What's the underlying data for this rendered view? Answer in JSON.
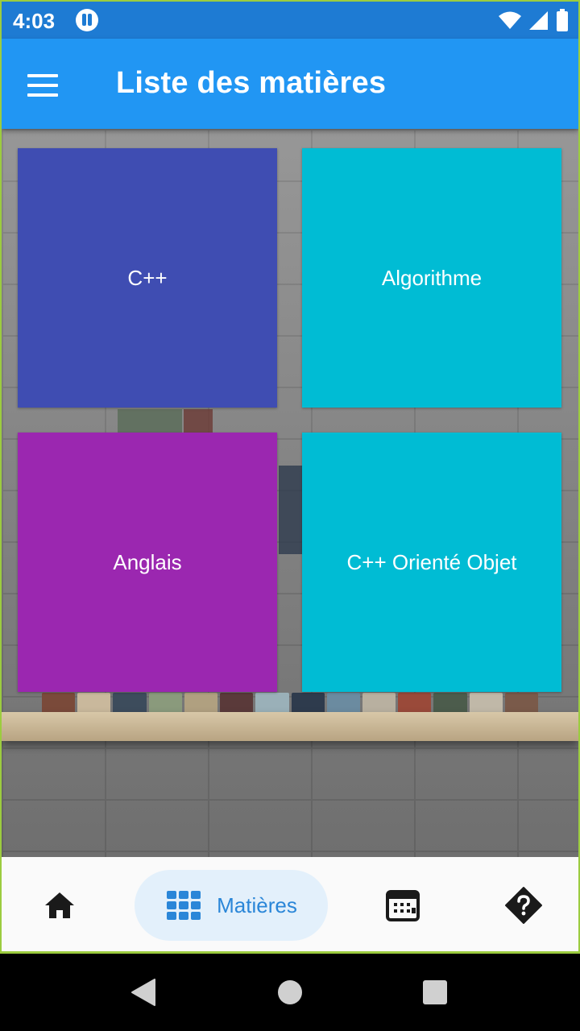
{
  "status_bar": {
    "time": "4:03",
    "icons": [
      "app-notification-icon",
      "wifi-icon",
      "cell-signal-icon",
      "battery-icon"
    ]
  },
  "app_bar": {
    "title": "Liste des matières",
    "menu_icon": "menu-icon"
  },
  "subjects": [
    {
      "label": "C++",
      "color": "#3f4db2"
    },
    {
      "label": "Algorithme",
      "color": "#00bcd4"
    },
    {
      "label": "Anglais",
      "color": "#9b27b0"
    },
    {
      "label": "C++ Orienté Objet",
      "color": "#00bcd4"
    }
  ],
  "bottom_nav": {
    "items": [
      {
        "icon": "home-icon",
        "label": "",
        "active": false
      },
      {
        "icon": "grid-icon",
        "label": "Matières",
        "active": true
      },
      {
        "icon": "calendar-icon",
        "label": "",
        "active": false
      },
      {
        "icon": "help-icon",
        "label": "",
        "active": false
      }
    ],
    "active_color": "#2a86d8",
    "active_bg": "#e3f0fb"
  },
  "system_nav": {
    "buttons": [
      "back-icon",
      "home-circle-icon",
      "recents-icon"
    ]
  }
}
